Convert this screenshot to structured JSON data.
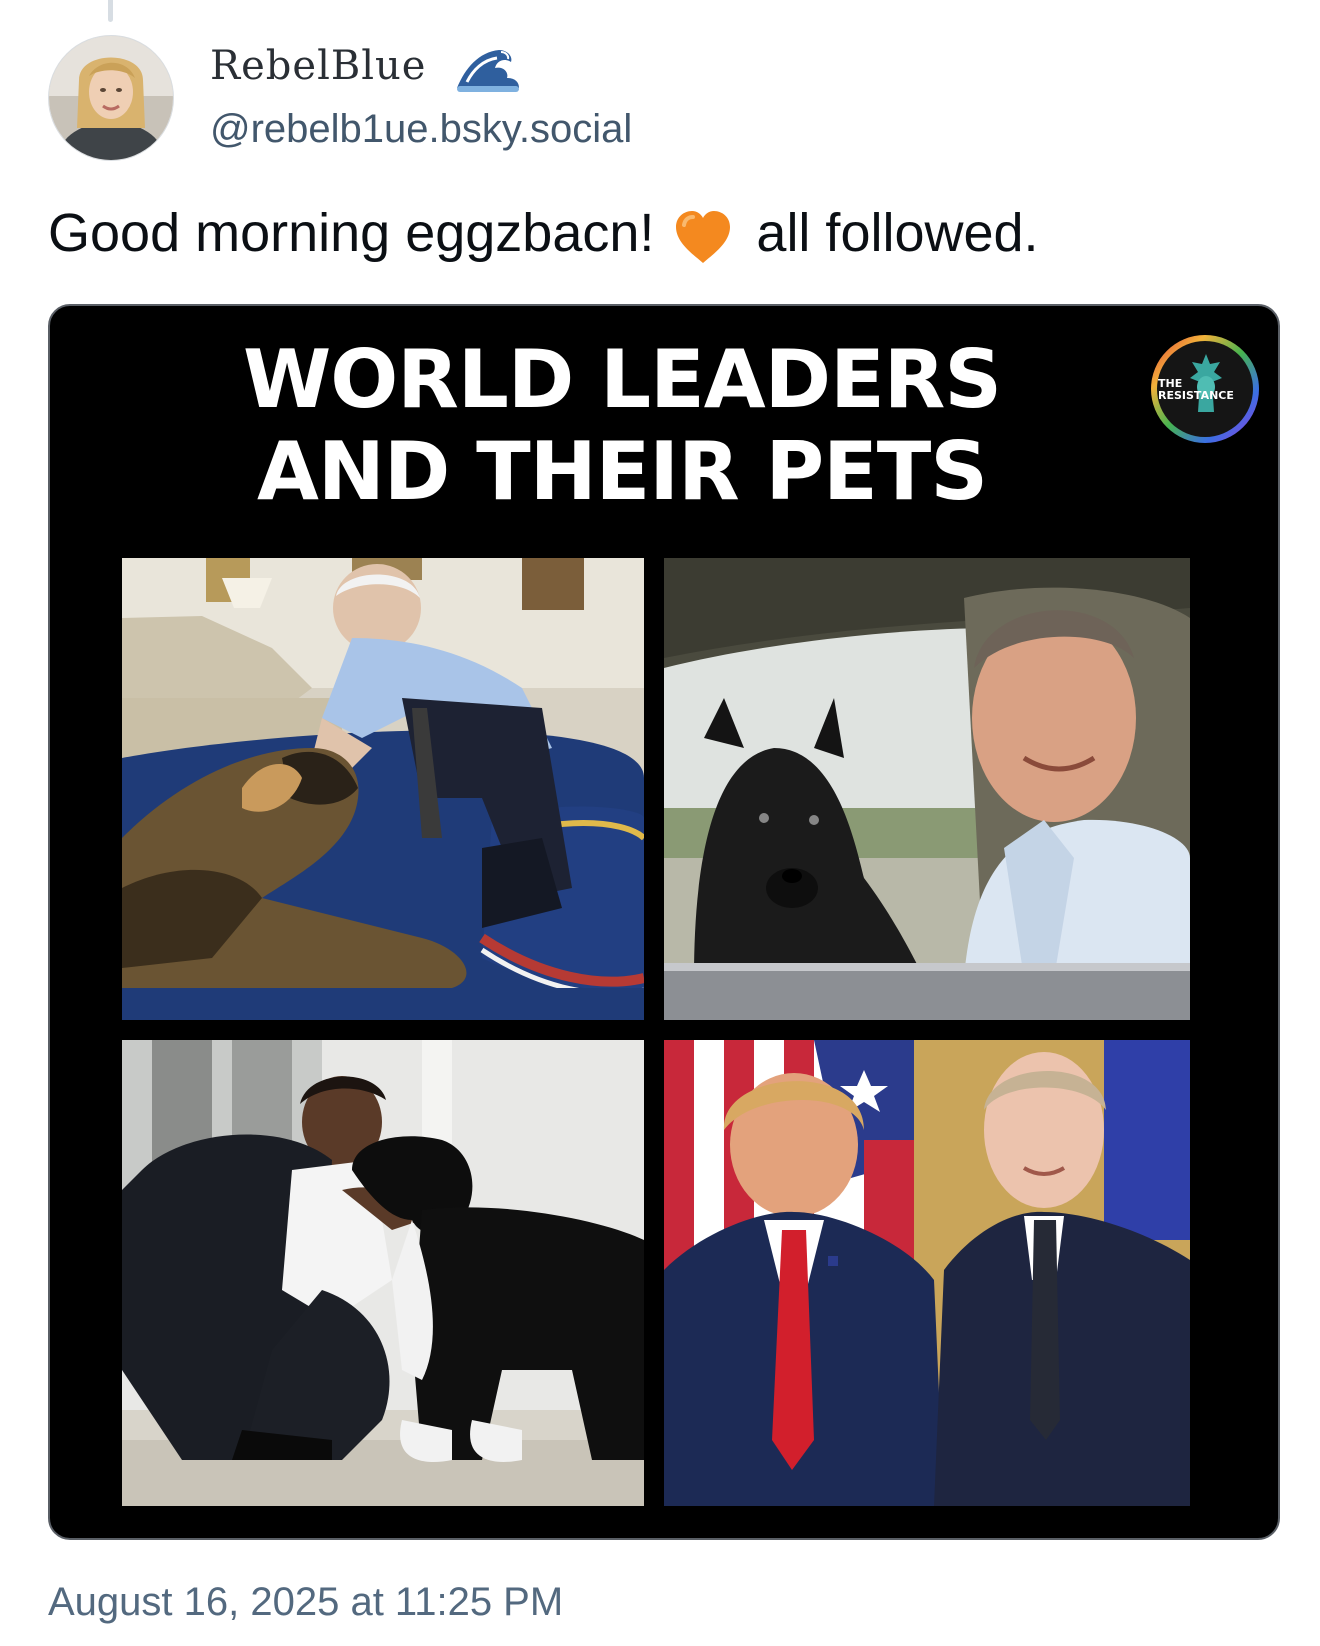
{
  "post": {
    "author": {
      "display_name": "RebelBlue",
      "handle": "@rebelb1ue.bsky.social",
      "name_icon": "ocean-wave-icon",
      "avatar": "avatar-photo"
    },
    "text_before": "Good morning eggzbacn!",
    "text_icon": "orange-heart-icon",
    "text_after": "all followed.",
    "timestamp": "August 16, 2025 at 11:25 PM"
  },
  "media": {
    "title_line1": "WORLD LEADERS",
    "title_line2": "AND THEIR PETS",
    "logo_text_line1": "THE",
    "logo_text_line2": "RESISTANCE",
    "panels": [
      "photo-man-petting-german-shepherd",
      "photo-man-with-black-scottish-terrier",
      "photo-man-petting-black-white-dog",
      "photo-two-men-in-suits-flags"
    ]
  },
  "colors": {
    "text_primary": "#0b0f14",
    "text_secondary": "#42576c",
    "heart": "#f4891f",
    "media_background": "#000000"
  }
}
